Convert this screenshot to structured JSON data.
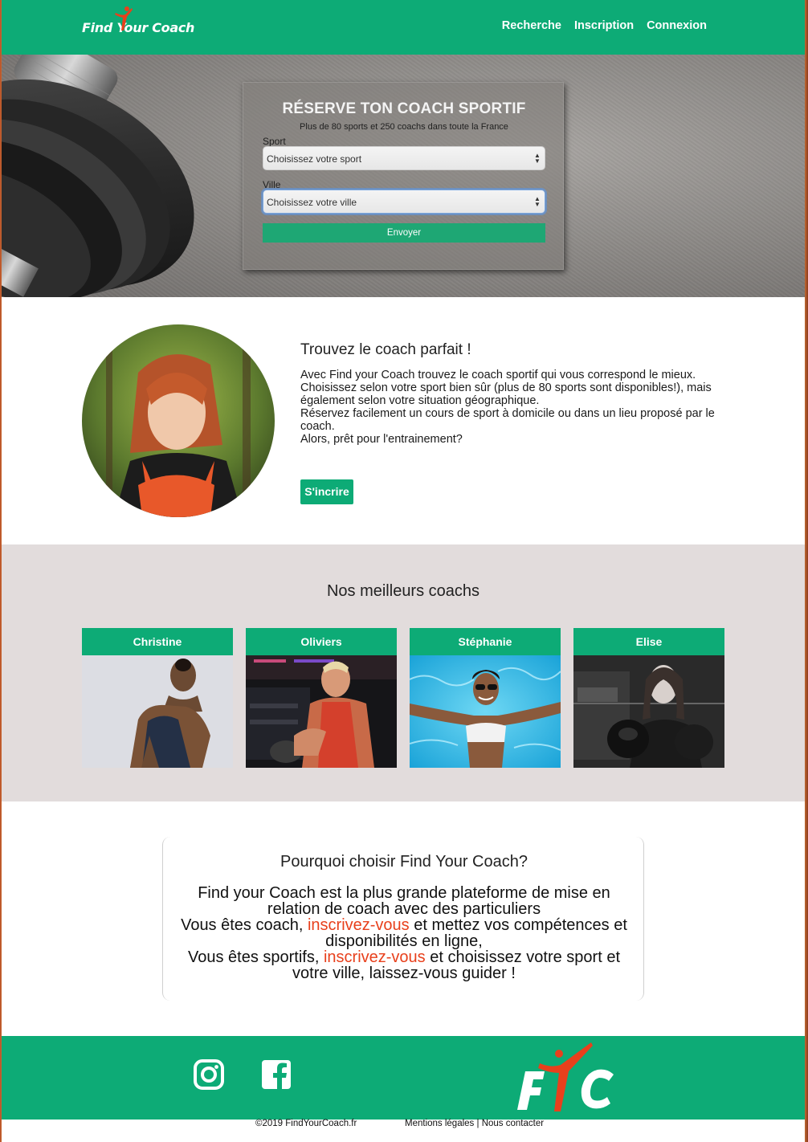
{
  "colors": {
    "brand": "#0dab76",
    "accent": "#e8401c",
    "coaches_bg": "#e2dcdc"
  },
  "navbar": {
    "logo": "Find Your Coach",
    "links": [
      "Recherche",
      "Inscription",
      "Connexion"
    ]
  },
  "hero": {
    "title": "RÉSERVE TON COACH SPORTIF",
    "subtitle": "Plus de 80 sports et 250 coachs dans toute la France",
    "sport_label": "Sport",
    "sport_value": "Choisissez votre sport",
    "city_label": "Ville",
    "city_value": "Choisissez votre ville",
    "submit": "Envoyer"
  },
  "about": {
    "title": "Trouvez le coach parfait !",
    "lines": [
      "Avec Find your Coach trouvez le coach sportif qui vous correspond le mieux.",
      "Choisissez selon votre sport bien sûr (plus de 80 sports sont disponibles!), mais également selon votre situation géographique.",
      "Réservez facilement un cours de sport à domicile ou dans un lieu proposé par le coach.",
      "Alors, prêt pour l'entrainement?"
    ],
    "button": "S'incrire"
  },
  "coaches": {
    "title": "Nos meilleurs coachs",
    "names": [
      "Christine",
      "Oliviers",
      "Stéphanie",
      "Elise"
    ]
  },
  "why": {
    "title": "Pourquoi choisir Find Your Coach?",
    "line1": "Find your Coach est la plus grande plateforme de mise en relation de coach avec des particuliers",
    "line2_pre": "Vous êtes coach, ",
    "line2_link": "inscrivez-vous",
    "line2_post": " et mettez vos compétences et disponibilités en ligne,",
    "line3_pre": "Vous êtes sportifs, ",
    "line3_link": "inscrivez-vous",
    "line3_post": " et choisissez votre sport et votre ville, laissez-vous guider !"
  },
  "footer": {
    "copyright": "©2019 FindYourCoach.fr",
    "legal": "Mentions légales",
    "separator": " | ",
    "contact": "Nous contacter",
    "icons": [
      "instagram-icon",
      "facebook-icon"
    ]
  }
}
